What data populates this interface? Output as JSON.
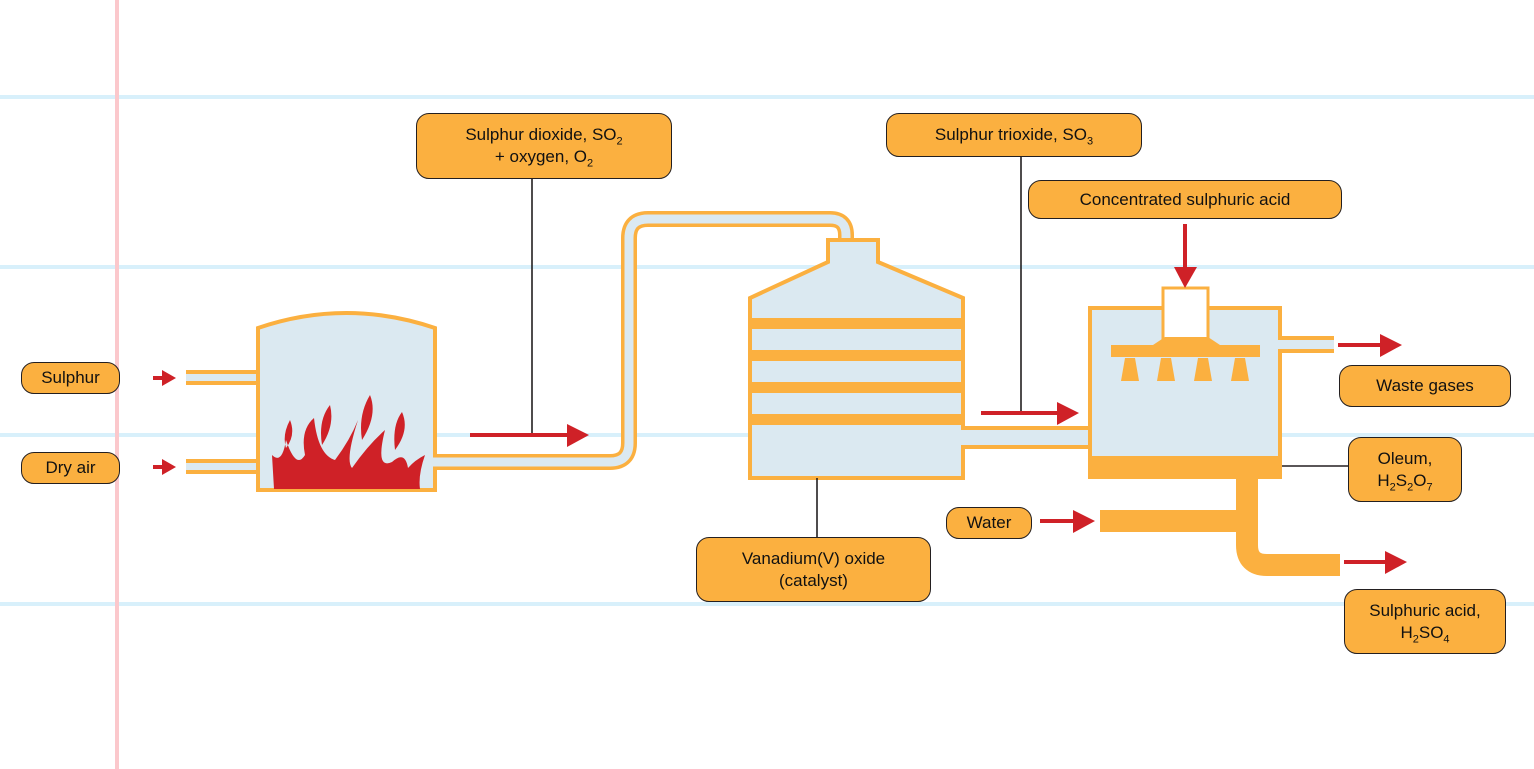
{
  "colors": {
    "pipe": "#fbb040",
    "fill": "#dbe9f1",
    "arrow": "#cf2127",
    "line": "#231f20",
    "rule": "#d8f0fb",
    "margin": "#fbc8cc"
  },
  "labels": {
    "sulphur": "Sulphur",
    "dry_air": "Dry air",
    "so2": {
      "line1_a": "Sulphur dioxide, SO",
      "line1_sub": "2",
      "line2_a": "+ oxygen, O",
      "line2_sub": "2"
    },
    "so3": {
      "a": "Sulphur trioxide, SO",
      "sub": "3"
    },
    "conc_acid": "Concentrated sulphuric acid",
    "waste_gases": "Waste gases",
    "oleum": {
      "line1": "Oleum,",
      "h": "H",
      "s1": "2",
      "s": "S",
      "s2": "2",
      "o": "O",
      "s3": "7"
    },
    "water": "Water",
    "catalyst": {
      "line1": "Vanadium(V) oxide",
      "line2": "(catalyst)"
    },
    "sulphuric_acid": {
      "line1": "Sulphuric acid,",
      "h": "H",
      "s1": "2",
      "so": "SO",
      "s2": "4"
    }
  }
}
